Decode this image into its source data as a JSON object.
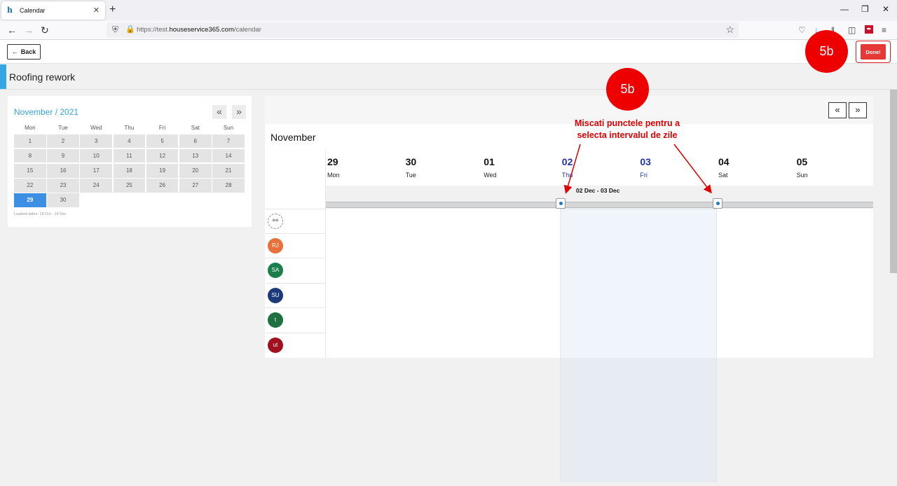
{
  "browser": {
    "tab_title": "Calendar",
    "tab_favicon": "h",
    "tab_close": "✕",
    "new_tab": "+",
    "url_prefix": "https://test.",
    "url_domain": "houseservice365.com",
    "url_path": "/calendar",
    "icons": [
      "back-arrow-icon",
      "forward-arrow-icon",
      "reload-icon",
      "shield-icon",
      "lock-icon",
      "star-icon",
      "pocket-icon",
      "download-icon",
      "library-icon",
      "sidebar-icon",
      "pdf-icon",
      "menu-icon"
    ]
  },
  "header": {
    "back_label": "Back",
    "done_label": "Done!",
    "page_title": "Roofing rework",
    "accent_color": "#35a5e4",
    "done_color": "#e53935"
  },
  "minical": {
    "title": "November / 2021",
    "prev": "«",
    "next": "»",
    "weekdays": [
      "Mon",
      "Tue",
      "Wed",
      "Thu",
      "Fri",
      "Sat",
      "Sun"
    ],
    "weeks": [
      [
        "1",
        "2",
        "3",
        "4",
        "5",
        "6",
        "7"
      ],
      [
        "8",
        "9",
        "10",
        "11",
        "12",
        "13",
        "14"
      ],
      [
        "15",
        "16",
        "17",
        "18",
        "19",
        "20",
        "21"
      ],
      [
        "22",
        "23",
        "24",
        "25",
        "26",
        "27",
        "28"
      ],
      [
        "29",
        "30",
        "",
        "",
        "",
        "",
        ""
      ]
    ],
    "selected": "29",
    "loaded_dates": "Loaded dates: 18 Oct - 14 Dec"
  },
  "maincal": {
    "month": "November",
    "prev": "«",
    "next": "»",
    "days": [
      {
        "num": "29",
        "name": "Mon",
        "highlight": false
      },
      {
        "num": "30",
        "name": "Tue",
        "highlight": false
      },
      {
        "num": "01",
        "name": "Wed",
        "highlight": false
      },
      {
        "num": "02",
        "name": "Thu",
        "highlight": true
      },
      {
        "num": "03",
        "name": "Fri",
        "highlight": true
      },
      {
        "num": "04",
        "name": "Sat",
        "highlight": false
      },
      {
        "num": "05",
        "name": "Sun",
        "highlight": false
      }
    ],
    "range_label": "02 Dec - 03 Dec",
    "unassigned_icon": "user-unassigned-icon",
    "avatars": [
      {
        "initials": "RJ",
        "color": "#e8703a"
      },
      {
        "initials": "SA",
        "color": "#1a7f4b"
      },
      {
        "initials": "SU",
        "color": "#1b3a7a"
      },
      {
        "initials": "t",
        "color": "#1f7040"
      },
      {
        "initials": "ut",
        "color": "#a0121d"
      }
    ]
  },
  "annotation": {
    "badge_top": "5b",
    "badge_header": "5b",
    "text_line1": "Miscati punctele pentru a",
    "text_line2": "selecta intervalul de zile",
    "color": "#ee0000"
  }
}
